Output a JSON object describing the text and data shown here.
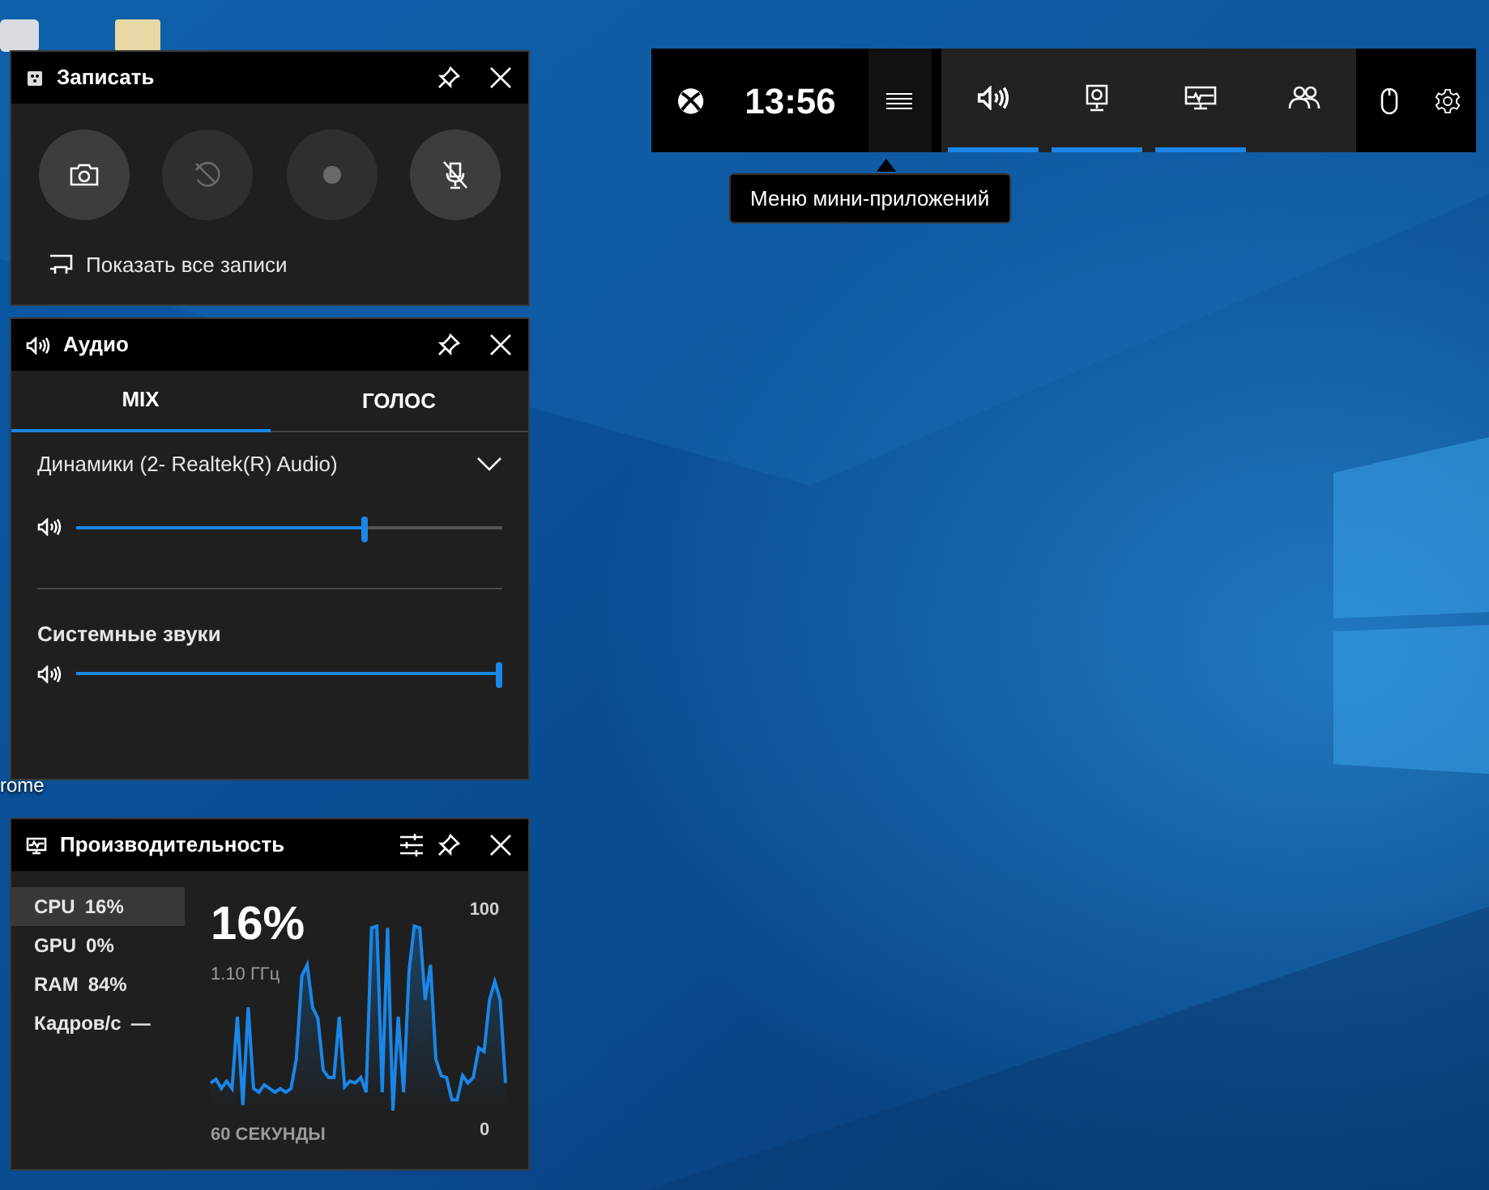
{
  "desktop": {
    "icon_label": "rome"
  },
  "game_bar": {
    "time": "13:56",
    "widget_menu": {
      "selected": true,
      "tooltip": "Меню мини-приложений"
    },
    "widgets": [
      {
        "kind": "audio",
        "active": true
      },
      {
        "kind": "capture",
        "active": true
      },
      {
        "kind": "performance",
        "active": true
      },
      {
        "kind": "social",
        "active": false
      }
    ],
    "tools": [
      {
        "kind": "mouse"
      },
      {
        "kind": "settings"
      }
    ]
  },
  "capture": {
    "title": "Записать",
    "buttons": [
      {
        "kind": "screenshot",
        "disabled": false
      },
      {
        "kind": "record_last",
        "disabled": true
      },
      {
        "kind": "record",
        "disabled": true
      },
      {
        "kind": "mic",
        "disabled": false
      }
    ],
    "show_all": "Показать все записи"
  },
  "audio": {
    "title": "Аудио",
    "tabs": [
      {
        "label": "MIX",
        "selected": true
      },
      {
        "label": "ГОЛОС",
        "selected": false
      }
    ],
    "channels": [
      {
        "name": "Динамики (2- Realtek(R) Audio)",
        "dropdown": true,
        "level": 0.68
      },
      {
        "name": "Системные звуки",
        "dropdown": false,
        "level": 1.0
      }
    ]
  },
  "performance": {
    "title": "Производительность",
    "metrics": [
      {
        "label": "CPU",
        "value": "16%",
        "selected": true
      },
      {
        "label": "GPU",
        "value": "0%",
        "selected": false
      },
      {
        "label": "RAM",
        "value": "84%",
        "selected": false
      },
      {
        "label": "Кадров/с",
        "value": "—",
        "selected": false
      }
    ],
    "big_value": "16%",
    "frequency": "1.10 ГГц",
    "scale_max": "100",
    "scale_min": "0",
    "time_label": "60 СЕКУНДЫ"
  }
}
